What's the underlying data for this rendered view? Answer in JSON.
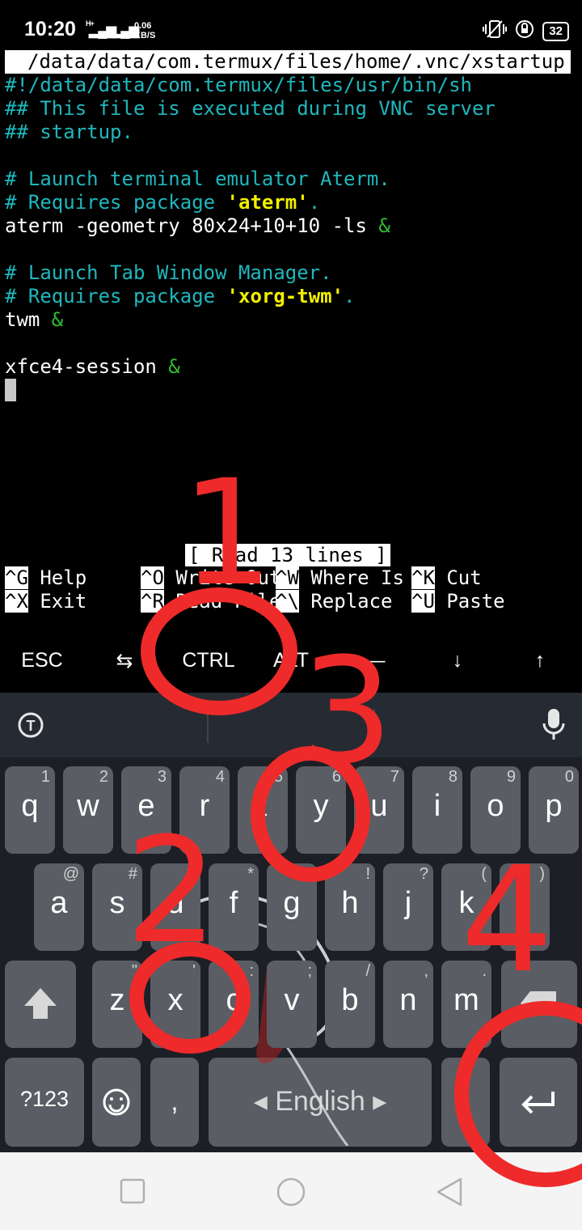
{
  "status_bar": {
    "time": "10:20",
    "net_speed_value": "0.06",
    "net_speed_unit": "KB/S",
    "network_type": "H+",
    "battery": "32"
  },
  "terminal": {
    "file_path": "/data/data/com.termux/files/home/.vnc/xstartup",
    "lines": [
      "#!/data/data/com.termux/files/usr/bin/sh",
      "## This file is executed during VNC server",
      "## startup.",
      "",
      "# Launch terminal emulator Aterm.",
      "# Requires package ",
      "'aterm'",
      ".",
      "aterm -geometry 80x24+10+10 -ls ",
      "&",
      "",
      "# Launch Tab Window Manager.",
      "# Requires package ",
      "'xorg-twm'",
      ".",
      "twm ",
      "&",
      "",
      "xfce4-session ",
      "&"
    ],
    "status_message": "[ Read 13 lines ]",
    "shortcuts": [
      {
        "key": "^G",
        "label": " Help"
      },
      {
        "key": "^O",
        "label": " Write Out"
      },
      {
        "key": "^W",
        "label": " Where Is"
      },
      {
        "key": "^K",
        "label": " Cut"
      },
      {
        "key": "^X",
        "label": " Exit"
      },
      {
        "key": "^R",
        "label": " Read File"
      },
      {
        "key": "^\\",
        "label": " Replace"
      },
      {
        "key": "^U",
        "label": " Paste"
      }
    ]
  },
  "extra_keys": [
    "ESC",
    "⇆",
    "CTRL",
    "ALT",
    "—",
    "↓",
    "↑"
  ],
  "keyboard": {
    "row1": [
      {
        "key": "q",
        "hint": "1"
      },
      {
        "key": "w",
        "hint": "2"
      },
      {
        "key": "e",
        "hint": "3"
      },
      {
        "key": "r",
        "hint": "4"
      },
      {
        "key": "t",
        "hint": "5"
      },
      {
        "key": "y",
        "hint": "6"
      },
      {
        "key": "u",
        "hint": "7"
      },
      {
        "key": "i",
        "hint": "8"
      },
      {
        "key": "o",
        "hint": "9"
      },
      {
        "key": "p",
        "hint": "0"
      }
    ],
    "row2": [
      {
        "key": "a",
        "hint": "@"
      },
      {
        "key": "s",
        "hint": "#"
      },
      {
        "key": "d",
        "hint": "$"
      },
      {
        "key": "f",
        "hint": "*"
      },
      {
        "key": "g",
        "hint": "-"
      },
      {
        "key": "h",
        "hint": "!"
      },
      {
        "key": "j",
        "hint": "?"
      },
      {
        "key": "k",
        "hint": "("
      },
      {
        "key": "l",
        "hint": ")"
      }
    ],
    "row3": [
      {
        "key": "z",
        "hint": "\""
      },
      {
        "key": "x",
        "hint": "'"
      },
      {
        "key": "c",
        "hint": ":"
      },
      {
        "key": "v",
        "hint": ";"
      },
      {
        "key": "b",
        "hint": "/"
      },
      {
        "key": "n",
        "hint": ","
      },
      {
        "key": "m",
        "hint": "."
      }
    ],
    "symbols_key": "?123",
    "comma_key": ",",
    "space_label": "English",
    "period_key": "."
  },
  "annotations": [
    "1",
    "2",
    "3",
    "4"
  ],
  "colors": {
    "annotation_red": "#ee2a2a",
    "terminal_cyan": "#1fb7bd",
    "terminal_yellow": "#f2ef00",
    "terminal_green": "#2fbd2f",
    "key_gray": "#5a5d63"
  },
  "icons": {
    "translate": "translate-icon",
    "mic": "microphone-icon",
    "shift": "shift-icon",
    "backspace": "backspace-icon",
    "emoji": "emoji-icon",
    "enter": "enter-icon",
    "nav_recent": "recent-apps-icon",
    "nav_home": "home-icon",
    "nav_back": "back-icon"
  }
}
